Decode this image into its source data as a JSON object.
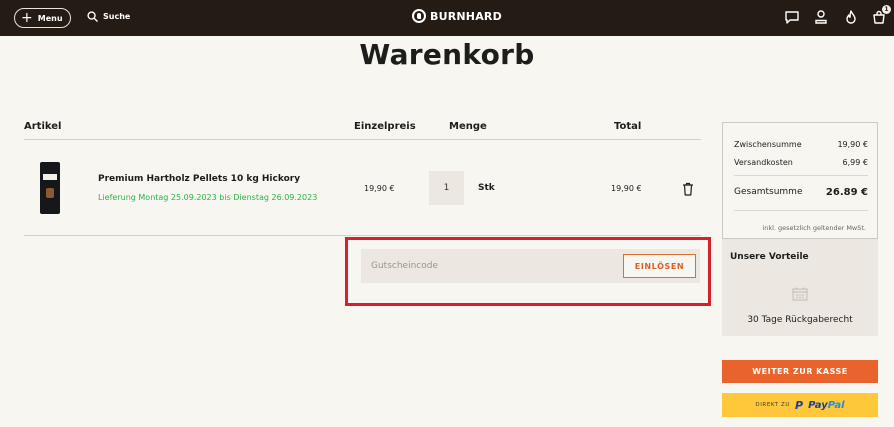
{
  "header": {
    "menu_label": "Menu",
    "search_label": "Suche",
    "logo_text": "BURNHARD",
    "cart_count": "1"
  },
  "page": {
    "title": "Warenkorb"
  },
  "table": {
    "columns": {
      "article": "Artikel",
      "unit_price": "Einzelpreis",
      "quantity": "Menge",
      "total": "Total"
    }
  },
  "cart_item": {
    "name": "Premium Hartholz Pellets 10 kg Hickory",
    "delivery": "Lieferung Montag 25.09.2023 bis Dienstag 26.09.2023",
    "unit_price": "19,90 €",
    "quantity": "1",
    "quantity_unit": "Stk",
    "total": "19,90 €"
  },
  "coupon": {
    "placeholder": "Gutscheincode",
    "button_label": "EINLÖSEN"
  },
  "summary": {
    "subtotal_label": "Zwischensumme",
    "subtotal_value": "19,90 €",
    "shipping_label": "Versandkosten",
    "shipping_value": "6,99 €",
    "total_label": "Gesamtsumme",
    "total_value": "26.89 €",
    "vat_note": "inkl. gesetzlich geltender MwSt."
  },
  "benefits": {
    "title": "Unsere Vorteile",
    "item": "30 Tage Rückgaberecht"
  },
  "checkout": {
    "button_label": "WEITER ZUR KASSE",
    "paypal_prefix": "DIREKT ZU",
    "paypal_pay": "Pay",
    "paypal_pal": "Pal",
    "paypal_mark": "P"
  },
  "colors": {
    "header_bg": "#231b14",
    "page_bg": "#f8f6f1",
    "accent_orange": "#e8642c",
    "delivery_green": "#2bb24c",
    "highlight_red": "#d4212b",
    "paypal_yellow": "#ffc83a"
  }
}
